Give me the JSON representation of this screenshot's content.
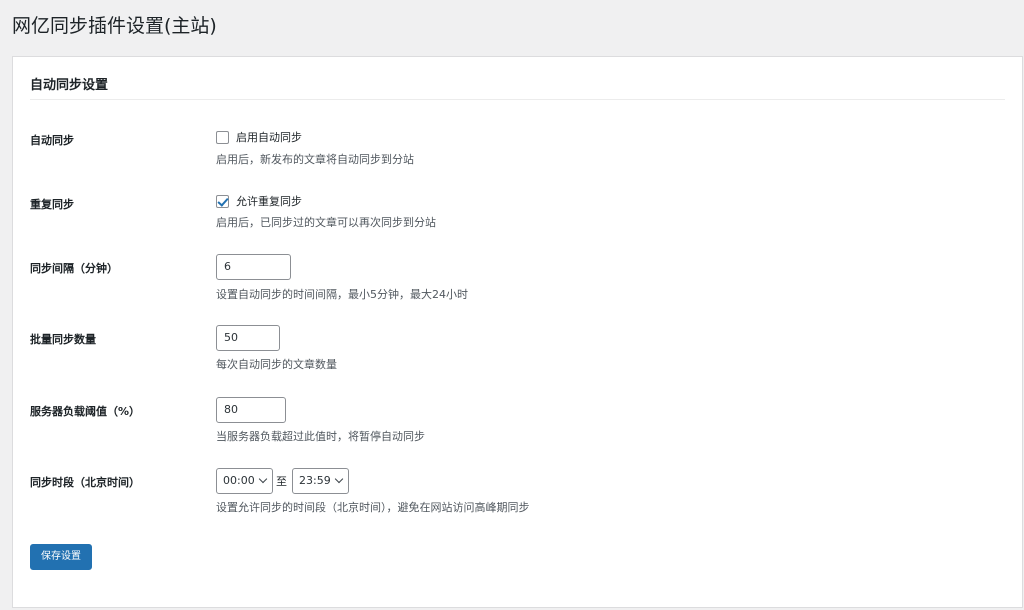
{
  "page": {
    "title": "网亿同步插件设置(主站)"
  },
  "card": {
    "title": "自动同步设置"
  },
  "fields": {
    "auto_sync": {
      "label": "自动同步",
      "checkbox_label": "启用自动同步",
      "checked": false,
      "description": "启用后，新发布的文章将自动同步到分站"
    },
    "repeat_sync": {
      "label": "重复同步",
      "checkbox_label": "允许重复同步",
      "checked": true,
      "description": "启用后，已同步过的文章可以再次同步到分站"
    },
    "sync_interval": {
      "label": "同步间隔（分钟）",
      "value": "6",
      "description": "设置自动同步的时间间隔，最小5分钟，最大24小时"
    },
    "batch_count": {
      "label": "批量同步数量",
      "value": "50",
      "description": "每次自动同步的文章数量"
    },
    "load_threshold": {
      "label": "服务器负载阈值（%）",
      "value": "80",
      "description": "当服务器负载超过此值时，将暂停自动同步"
    },
    "sync_period": {
      "label": "同步时段（北京时间）",
      "start": "00:00",
      "to": "至",
      "end": "23:59",
      "description": "设置允许同步的时间段（北京时间），避免在网站访问高峰期同步"
    }
  },
  "buttons": {
    "save_label": "保存设置"
  },
  "colors": {
    "primary": "#2271b1",
    "background": "#f0f0f1"
  }
}
